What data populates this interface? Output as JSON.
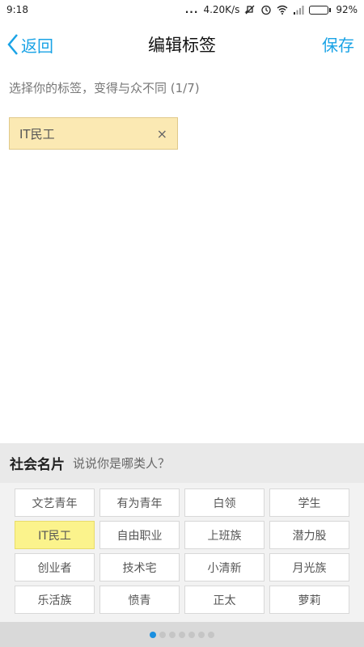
{
  "status": {
    "time": "9:18",
    "dots": "...",
    "speed": "4.20K/s",
    "battery": "92%",
    "battery_level": 0.92
  },
  "nav": {
    "back_label": "返回",
    "title": "编辑标签",
    "save_label": "保存"
  },
  "hint": "选择你的标签，变得与众不同 (1/7)",
  "selected_chip": {
    "label": "IT民工",
    "close": "×"
  },
  "panel": {
    "title": "社会名片",
    "subtitle": "说说你是哪类人？"
  },
  "tags": [
    {
      "label": "文艺青年",
      "selected": false
    },
    {
      "label": "有为青年",
      "selected": false
    },
    {
      "label": "白领",
      "selected": false
    },
    {
      "label": "学生",
      "selected": false
    },
    {
      "label": "IT民工",
      "selected": true
    },
    {
      "label": "自由职业",
      "selected": false
    },
    {
      "label": "上班族",
      "selected": false
    },
    {
      "label": "潜力股",
      "selected": false
    },
    {
      "label": "创业者",
      "selected": false
    },
    {
      "label": "技术宅",
      "selected": false
    },
    {
      "label": "小清新",
      "selected": false
    },
    {
      "label": "月光族",
      "selected": false
    },
    {
      "label": "乐活族",
      "selected": false
    },
    {
      "label": "愤青",
      "selected": false
    },
    {
      "label": "正太",
      "selected": false
    },
    {
      "label": "萝莉",
      "selected": false
    }
  ],
  "pager": {
    "pages": 7,
    "active": 0
  },
  "colors": {
    "accent": "#1aa3e6",
    "chip_bg": "#fbe9b3",
    "selected_tag": "#fbf38c",
    "pager_active": "#1a8fe0"
  }
}
